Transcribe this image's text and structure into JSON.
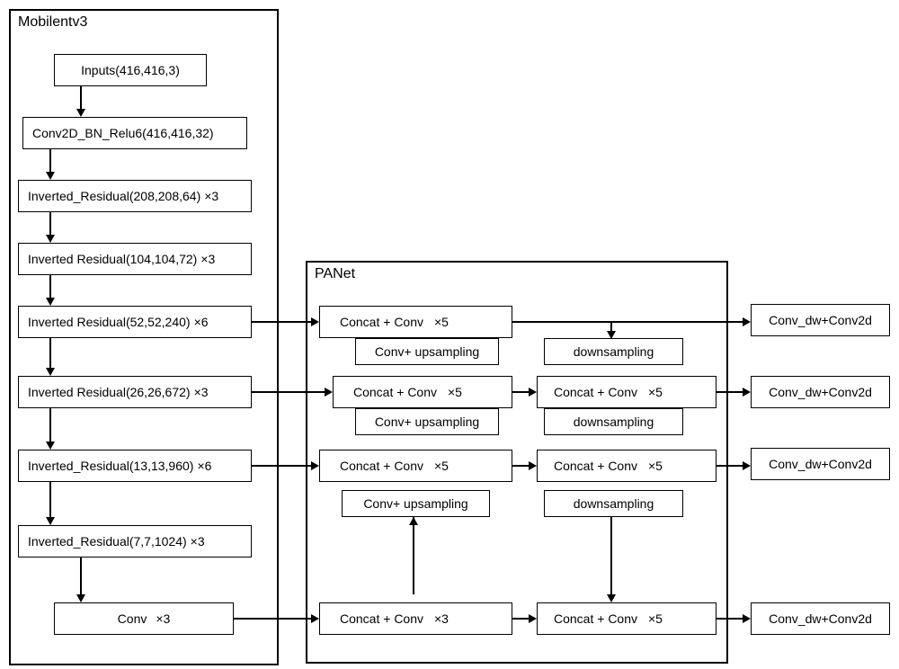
{
  "groups": {
    "mobilenet": "Mobilentv3",
    "panet": "PANet"
  },
  "mobilenet": {
    "inputs": "Inputs(416,416,3)",
    "conv2d": "Conv2D_BN_Relu6(416,416,32)",
    "ir1": "Inverted_Residual(208,208,64)",
    "ir1_x": "×3",
    "ir2": "Inverted Residual(104,104,72)",
    "ir2_x": "×3",
    "ir3": "Inverted Residual(52,52,240)",
    "ir3_x": "×6",
    "ir4": "Inverted Residual(26,26,672)",
    "ir4_x": "×3",
    "ir5": "Inverted_Residual(13,13,960)",
    "ir5_x": "×6",
    "ir6": "Inverted_Residual(7,7,1024)",
    "ir6_x": "×3",
    "conv": "Conv",
    "conv_x": "×3"
  },
  "panet": {
    "cc1": "Concat + Conv",
    "cc1_x": "×5",
    "up1": "Conv+ upsampling",
    "cc2": "Concat + Conv",
    "cc2_x": "×5",
    "up2": "Conv+ upsampling",
    "cc3": "Concat + Conv",
    "cc3_x": "×5",
    "up3": "Conv+ upsampling",
    "cc4": "Concat + Conv",
    "cc4_x": "×3",
    "ds1": "downsampling",
    "ds2": "downsampling",
    "ds3": "downsampling",
    "rcc2": "Concat + Conv",
    "rcc2_x": "×5",
    "rcc3": "Concat + Conv",
    "rcc3_x": "×5",
    "rcc4": "Concat + Conv",
    "rcc4_x": "×5"
  },
  "outputs": {
    "o1": "Conv_dw+Conv2d",
    "o2": "Conv_dw+Conv2d",
    "o3": "Conv_dw+Conv2d",
    "o4": "Conv_dw+Conv2d"
  }
}
